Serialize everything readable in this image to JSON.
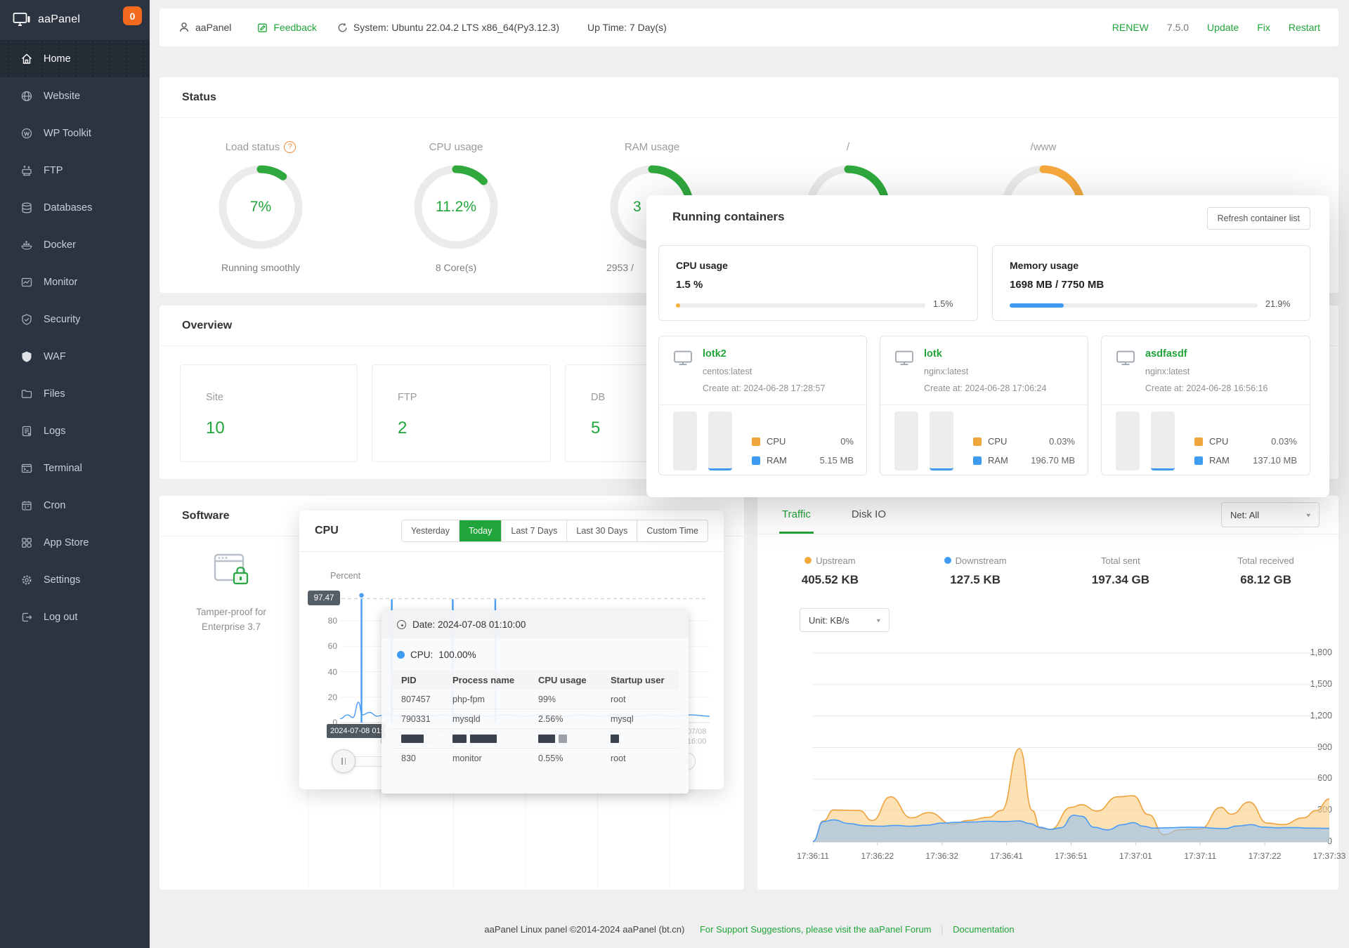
{
  "brand": {
    "name": "aaPanel",
    "badge": "0"
  },
  "sidebar": {
    "items": [
      {
        "label": "Home",
        "active": true
      },
      {
        "label": "Website"
      },
      {
        "label": "WP Toolkit"
      },
      {
        "label": "FTP"
      },
      {
        "label": "Databases"
      },
      {
        "label": "Docker"
      },
      {
        "label": "Monitor"
      },
      {
        "label": "Security"
      },
      {
        "label": "WAF"
      },
      {
        "label": "Files"
      },
      {
        "label": "Logs"
      },
      {
        "label": "Terminal"
      },
      {
        "label": "Cron"
      },
      {
        "label": "App Store"
      },
      {
        "label": "Settings"
      },
      {
        "label": "Log out"
      }
    ]
  },
  "topbar": {
    "account": "aaPanel",
    "feedback": "Feedback",
    "system": "System: Ubuntu 22.04.2 LTS x86_64(Py3.12.3)",
    "uptime": "Up Time: 7 Day(s)",
    "renew": "RENEW",
    "version": "7.5.0",
    "update": "Update",
    "fix": "Fix",
    "restart": "Restart"
  },
  "status": {
    "title": "Status",
    "gauges": [
      {
        "label": "Load status",
        "value": "7%",
        "sub": "Running smoothly",
        "percent": 10,
        "color": "#2fa83d",
        "help": true
      },
      {
        "label": "CPU usage",
        "value": "11.2%",
        "sub": "8 Core(s)",
        "percent": 13,
        "color": "#2fa83d"
      },
      {
        "label": "RAM usage",
        "value": "3",
        "sub": "2953 /",
        "percent": 38,
        "color": "#2fa83d",
        "clipped": true
      },
      {
        "label": "/",
        "value": "",
        "sub": "",
        "percent": 28,
        "color": "#2fa83d"
      },
      {
        "label": "/www",
        "value": "",
        "sub": "",
        "percent": 45,
        "color": "#f5a83c"
      }
    ]
  },
  "overview": {
    "title": "Overview",
    "cards": [
      {
        "label": "Site",
        "value": "10"
      },
      {
        "label": "FTP",
        "value": "2"
      },
      {
        "label": "DB",
        "value": "5"
      }
    ]
  },
  "software": {
    "title": "Software",
    "item": {
      "line1": "Tamper-proof for",
      "line2": "Enterprise 3.7"
    }
  },
  "cpu_popup": {
    "title": "CPU",
    "ranges": [
      "Yesterday",
      "Today",
      "Last 7 Days",
      "Last 30 Days",
      "Custom Time"
    ],
    "active_range": "Today",
    "ylabel": "Percent",
    "max_badge": "97.47",
    "y_ticks": [
      "80",
      "60",
      "40",
      "20",
      "0"
    ],
    "axis_badge": "2024-07-08 01:1",
    "tooltip": {
      "date": "Date: 2024-07-08 01:10:00",
      "cpu_label": "CPU:",
      "cpu_value": "100.00%",
      "headers": [
        "PID",
        "Process name",
        "CPU usage",
        "Startup user"
      ],
      "rows": [
        {
          "pid": "807457",
          "process": "php-fpm",
          "cpu": "99%",
          "user": "root"
        },
        {
          "pid": "790331",
          "process": "mysqld",
          "cpu": "2.56%",
          "user": "mysql"
        },
        {
          "redacted": true
        },
        {
          "pid": "830",
          "process": "monitor",
          "cpu": "0.55%",
          "user": "root"
        }
      ]
    }
  },
  "traffic": {
    "tabs": [
      "Traffic",
      "Disk IO"
    ],
    "active_tab": "Traffic",
    "net_select": "Net: All",
    "unit_select": "Unit: KB/s",
    "stats": [
      {
        "label": "Upstream",
        "value": "405.52 KB",
        "dot": "#f5a83c"
      },
      {
        "label": "Downstream",
        "value": "127.5 KB",
        "dot": "#3f9bf2"
      },
      {
        "label": "Total sent",
        "value": "197.34 GB"
      },
      {
        "label": "Total received",
        "value": "68.12 GB"
      }
    ]
  },
  "modal": {
    "title": "Running containers",
    "refresh": "Refresh container list",
    "cpu_card": {
      "label": "CPU usage",
      "value": "1.5 %",
      "percent": 1.5,
      "percent_label": "1.5%",
      "color": "#f7b13c"
    },
    "memory_card": {
      "label": "Memory usage",
      "value": "1698 MB / 7750 MB",
      "percent": 21.9,
      "percent_label": "21.9%",
      "color": "#3f9bf2"
    },
    "legend": {
      "cpu": "CPU",
      "ram": "RAM"
    },
    "containers": [
      {
        "name": "lotk2",
        "image": "centos:latest",
        "created": "Create at: 2024-06-28 17:28:57",
        "cpu": "0%",
        "ram": "5.15 MB"
      },
      {
        "name": "lotk",
        "image": "nginx:latest",
        "created": "Create at: 2024-06-28 17:06:24",
        "cpu": "0.03%",
        "ram": "196.70 MB"
      },
      {
        "name": "asdfasdf",
        "image": "nginx:latest",
        "created": "Create at: 2024-06-28 16:56:16",
        "cpu": "0.03%",
        "ram": "137.10 MB"
      }
    ]
  },
  "footer": {
    "copyright": "aaPanel Linux panel ©2014-2024 aaPanel (bt.cn)",
    "support": "For Support Suggestions, please visit the aaPanel Forum",
    "divider": "|",
    "docs": "Documentation"
  },
  "chart_data": [
    {
      "id": "traffic",
      "type": "area",
      "title": "Traffic",
      "unit": "KB/s",
      "ylim": [
        0,
        1800
      ],
      "y_ticks": [
        "1,800",
        "1,500",
        "1,200",
        "900",
        "600",
        "300",
        "0"
      ],
      "x_labels": [
        "17:36:11",
        "17:36:22",
        "17:36:32",
        "17:36:41",
        "17:36:51",
        "17:37:01",
        "17:37:11",
        "17:37:22",
        "17:37:33"
      ],
      "series": [
        {
          "name": "Upstream",
          "stroke": "#eea23e",
          "fill": "rgba(248,205,130,0.6)",
          "points": [
            [
              0,
              5
            ],
            [
              0.02,
              200
            ],
            [
              0.04,
              305
            ],
            [
              0.09,
              300
            ],
            [
              0.115,
              205
            ],
            [
              0.15,
              430
            ],
            [
              0.19,
              230
            ],
            [
              0.225,
              280
            ],
            [
              0.27,
              170
            ],
            [
              0.3,
              205
            ],
            [
              0.34,
              235
            ],
            [
              0.365,
              300
            ],
            [
              0.4,
              890
            ],
            [
              0.425,
              300
            ],
            [
              0.44,
              130
            ],
            [
              0.46,
              120
            ],
            [
              0.5,
              330
            ],
            [
              0.52,
              355
            ],
            [
              0.55,
              295
            ],
            [
              0.59,
              430
            ],
            [
              0.62,
              440
            ],
            [
              0.65,
              260
            ],
            [
              0.68,
              70
            ],
            [
              0.71,
              115
            ],
            [
              0.75,
              125
            ],
            [
              0.79,
              330
            ],
            [
              0.81,
              265
            ],
            [
              0.845,
              380
            ],
            [
              0.88,
              180
            ],
            [
              0.91,
              165
            ],
            [
              0.95,
              230
            ],
            [
              0.975,
              300
            ],
            [
              1,
              410
            ]
          ]
        },
        {
          "name": "Downstream",
          "stroke": "#4a9cf5",
          "fill": "rgba(148,191,238,0.6)",
          "points": [
            [
              0,
              5
            ],
            [
              0.02,
              195
            ],
            [
              0.04,
              210
            ],
            [
              0.07,
              175
            ],
            [
              0.1,
              155
            ],
            [
              0.13,
              150
            ],
            [
              0.16,
              158
            ],
            [
              0.19,
              150
            ],
            [
              0.22,
              160
            ],
            [
              0.25,
              180
            ],
            [
              0.28,
              188
            ],
            [
              0.31,
              190
            ],
            [
              0.34,
              198
            ],
            [
              0.37,
              195
            ],
            [
              0.4,
              200
            ],
            [
              0.42,
              175
            ],
            [
              0.44,
              140
            ],
            [
              0.46,
              120
            ],
            [
              0.48,
              135
            ],
            [
              0.505,
              255
            ],
            [
              0.52,
              245
            ],
            [
              0.545,
              140
            ],
            [
              0.57,
              115
            ],
            [
              0.6,
              165
            ],
            [
              0.62,
              185
            ],
            [
              0.64,
              150
            ],
            [
              0.66,
              132
            ],
            [
              0.69,
              136
            ],
            [
              0.72,
              140
            ],
            [
              0.75,
              140
            ],
            [
              0.78,
              130
            ],
            [
              0.8,
              128
            ],
            [
              0.82,
              152
            ],
            [
              0.85,
              165
            ],
            [
              0.87,
              142
            ],
            [
              0.9,
              135
            ],
            [
              0.93,
              138
            ],
            [
              0.96,
              132
            ],
            [
              1,
              130
            ]
          ]
        }
      ]
    },
    {
      "id": "cpu",
      "type": "spike",
      "ylabel": "Percent",
      "ylim": [
        0,
        100
      ],
      "max_line": 97.47,
      "spikes": [
        [
          0.058,
          100
        ],
        [
          0.14,
          97
        ],
        [
          0.305,
          97
        ],
        [
          0.42,
          97
        ]
      ],
      "baseline": [
        [
          0,
          3
        ],
        [
          0.02,
          6
        ],
        [
          0.035,
          4
        ],
        [
          0.05,
          16
        ],
        [
          0.06,
          6
        ],
        [
          0.08,
          8
        ],
        [
          0.1,
          5
        ],
        [
          0.13,
          7
        ],
        [
          0.16,
          5
        ],
        [
          0.2,
          6
        ],
        [
          0.24,
          5
        ],
        [
          0.28,
          6
        ],
        [
          0.32,
          5
        ],
        [
          0.36,
          6
        ],
        [
          0.4,
          5
        ],
        [
          0.45,
          6
        ],
        [
          0.5,
          5
        ],
        [
          0.55,
          6
        ],
        [
          0.6,
          5
        ],
        [
          0.65,
          6
        ],
        [
          0.7,
          5
        ],
        [
          0.75,
          6
        ],
        [
          0.8,
          5
        ],
        [
          0.85,
          6
        ],
        [
          0.9,
          5
        ],
        [
          0.95,
          6
        ],
        [
          1,
          5
        ]
      ],
      "ghost_x_labels": [
        {
          "f": 0.135,
          "top": "07/08",
          "bottom": "02:00"
        },
        {
          "f": 0.255,
          "top": "07/08",
          "bottom": "04:00"
        },
        {
          "f": 0.375,
          "top": "07/08",
          "bottom": "06:00"
        },
        {
          "f": 0.495,
          "top": "07/08",
          "bottom": "08:00"
        },
        {
          "f": 0.615,
          "top": "07/08",
          "bottom": "10:00"
        },
        {
          "f": 0.735,
          "top": "07/08",
          "bottom": "12:00"
        },
        {
          "f": 0.855,
          "top": "07/08",
          "bottom": "14:00"
        },
        {
          "f": 0.965,
          "top": "07/08",
          "bottom": "16:00"
        }
      ]
    }
  ]
}
